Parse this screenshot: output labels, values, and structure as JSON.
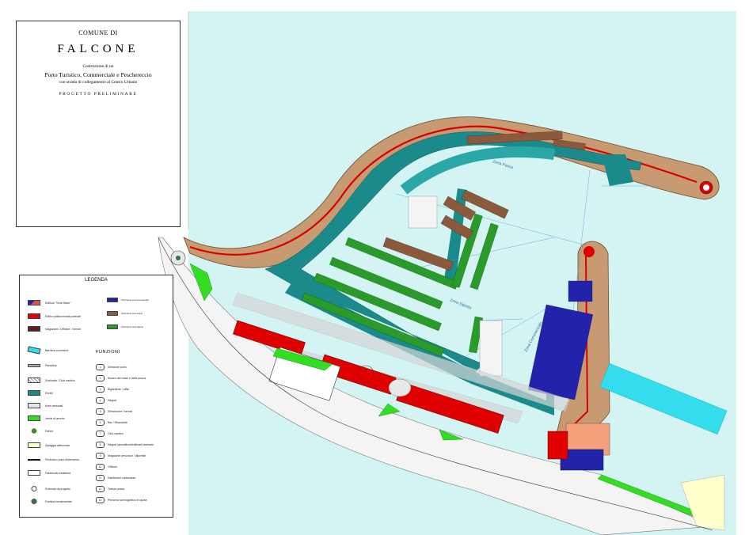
{
  "title_block": {
    "line1": "COMUNE DI",
    "line2": "FALCONE",
    "line3": "Costruzione di un",
    "line4": "Porto Turistico, Commerciale e Peschereccio",
    "line5": "con strada di collegamento al Centro Urbano",
    "line6": "PROGETTO PRELIMINARE"
  },
  "legend": {
    "title": "LEGENDA",
    "items": [
      {
        "label": "Edificio \"Torre Mare\"",
        "color": "#d9574f"
      },
      {
        "label": "Edifici polifunzionali porticati",
        "color": "#e00000"
      },
      {
        "label": "Magazzini / Officine / Servizi",
        "color": "#5a1e1e"
      },
      {
        "label": "Barriera commerci",
        "color": "#33ddee"
      },
      {
        "label": "Pensiline",
        "color": "#b0b0b0"
      },
      {
        "label": "Scalinata / Club nautico",
        "color": "#e8e8e8"
      },
      {
        "label": "Pontili",
        "color": "#1a8a8a"
      },
      {
        "label": "Aree pedonali",
        "color": "#e6e6e6"
      },
      {
        "label": "Verde di arredo",
        "color": "#33dd22"
      },
      {
        "label": "Palme",
        "color": "#4a8a2a"
      },
      {
        "label": "Spiaggia attrezzata",
        "color": "#ffffcc"
      },
      {
        "label": "Perimetro area d'intervento",
        "color": "#111111"
      },
      {
        "label": "Fabbricato esistente",
        "color": "#ffffff"
      },
      {
        "label": "Rotonda di progetto",
        "color": "#ffffff"
      },
      {
        "label": "Fontana ornamentale",
        "color": "#2a7a3a"
      }
    ],
    "berth_items": [
      {
        "label": "Posti barca zona commerciale",
        "color": "#2222aa"
      },
      {
        "label": "Posti barca zona pesca",
        "color": "#8b5a3c"
      },
      {
        "label": "Posti barca zona diporto",
        "color": "#2a9a2a"
      }
    ],
    "funzioni_title": "FUNZIONI",
    "funzioni": [
      {
        "n": "1",
        "label": "Direzione porto"
      },
      {
        "n": "2",
        "label": "Museo del mare e della pesca"
      },
      {
        "n": "3",
        "label": "Biglietterie / uffici"
      },
      {
        "n": "4",
        "label": "Negozi"
      },
      {
        "n": "5",
        "label": "Direzionale / servizi"
      },
      {
        "n": "6",
        "label": "Bar / Ristorante"
      },
      {
        "n": "7",
        "label": "Club nautico"
      },
      {
        "n": "8",
        "label": "Negozi specializzati attività marinare"
      },
      {
        "n": "9",
        "label": "Magazzini pescatori / diportisti"
      },
      {
        "n": "10",
        "label": "Officine"
      },
      {
        "n": "11",
        "label": "Distributori carburante"
      },
      {
        "n": "12",
        "label": "Tettoia pesca"
      },
      {
        "n": "13",
        "label": "Percorso scenografico in quota"
      }
    ]
  },
  "map_labels": {
    "zona_pesca": "Zona Pesca",
    "zona_diporto": "Zona Diporto",
    "zona_commerciale": "Zona Commerciale"
  },
  "colors": {
    "sea": "#d4f4f4",
    "quay": "#c89a72",
    "pontile": "#1a8a8a",
    "building_red": "#e00000",
    "berth_green": "#2a9a2a",
    "berth_brown": "#8b5a3c",
    "berth_blue": "#2222aa",
    "barrier": "#33ddee"
  }
}
